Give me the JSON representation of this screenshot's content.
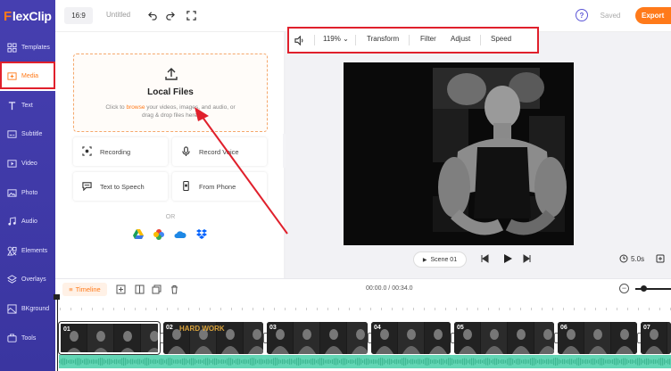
{
  "app": {
    "logo_first": "F",
    "logo_rest": "lexClip"
  },
  "sidebar": {
    "items": [
      {
        "label": "Templates",
        "icon": "templates-icon"
      },
      {
        "label": "Media",
        "icon": "media-icon"
      },
      {
        "label": "Text",
        "icon": "text-icon"
      },
      {
        "label": "Subtitle",
        "icon": "subtitle-icon"
      },
      {
        "label": "Video",
        "icon": "video-icon"
      },
      {
        "label": "Photo",
        "icon": "photo-icon"
      },
      {
        "label": "Audio",
        "icon": "audio-icon"
      },
      {
        "label": "Elements",
        "icon": "elements-icon"
      },
      {
        "label": "Overlays",
        "icon": "overlays-icon"
      },
      {
        "label": "BKground",
        "icon": "background-icon"
      },
      {
        "label": "Tools",
        "icon": "tools-icon"
      }
    ],
    "active": "Media"
  },
  "topbar": {
    "ratio": "16:9",
    "title": "Untitled",
    "help": "?",
    "saved": "Saved",
    "export": "Export"
  },
  "media_panel": {
    "upload_title": "Local Files",
    "upload_desc_pre": "Click to ",
    "upload_desc_link": "browse",
    "upload_desc_post": " your videos, images, and audio, or drag & drop files here.",
    "tools": [
      "Recording",
      "Record Voice",
      "Text to Speech",
      "From Phone"
    ],
    "or": "OR",
    "clouds": [
      "google-drive-icon",
      "google-photos-icon",
      "onedrive-icon",
      "dropbox-icon"
    ]
  },
  "prop_toolbar": {
    "zoom": "119%",
    "transform": "Transform",
    "filter": "Filter",
    "adjust": "Adjust",
    "speed": "Speed"
  },
  "player": {
    "scene": "Scene 01",
    "duration": "5.0s"
  },
  "timeline": {
    "label": "Timeline",
    "time": "00:00.0 / 00:34.0",
    "clips": [
      {
        "num": "01"
      },
      {
        "num": "02",
        "caption": "HARD WORK"
      },
      {
        "num": "03"
      },
      {
        "num": "04"
      },
      {
        "num": "05"
      },
      {
        "num": "06"
      },
      {
        "num": "07"
      }
    ]
  },
  "colors": {
    "brand": "#ff7a1a",
    "sidebar": "#3f3aa3",
    "highlight": "#e0202c",
    "audio": "#63d6b5"
  }
}
